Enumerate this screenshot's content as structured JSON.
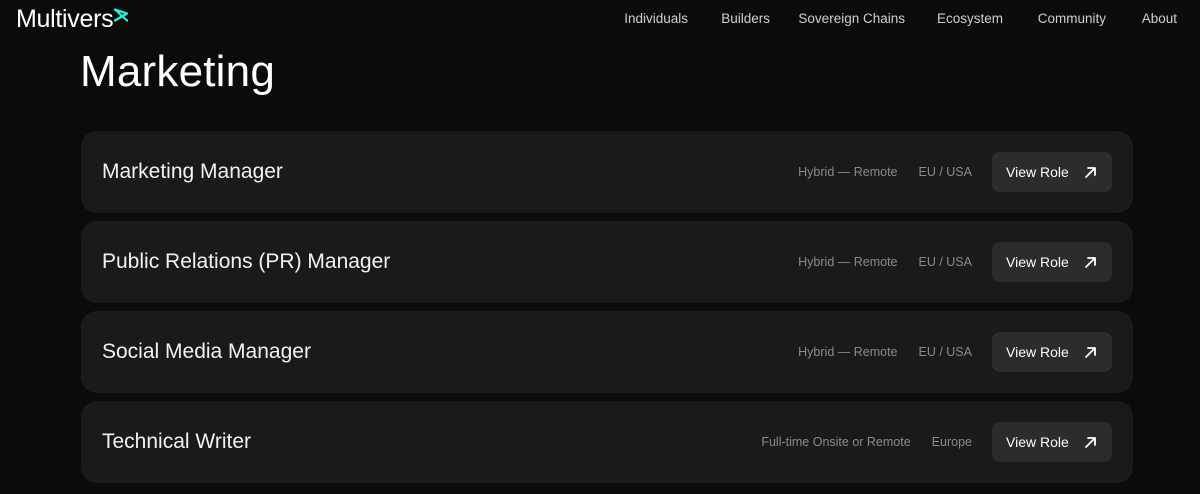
{
  "brand": {
    "name": "Multivers",
    "accent_color": "#23f7dd"
  },
  "nav": {
    "items": [
      {
        "label": "Individuals"
      },
      {
        "label": "Builders"
      },
      {
        "label": "Sovereign Chains"
      },
      {
        "label": "Ecosystem"
      },
      {
        "label": "Community"
      },
      {
        "label": "About"
      }
    ]
  },
  "section": {
    "title": "Marketing"
  },
  "jobs": [
    {
      "title": "Marketing Manager",
      "type": "Hybrid — Remote",
      "location": "EU / USA",
      "button_label": "View Role",
      "button_icon": "arrow-up-right-icon"
    },
    {
      "title": "Public Relations (PR) Manager",
      "type": "Hybrid — Remote",
      "location": "EU / USA",
      "button_label": "View Role",
      "button_icon": "arrow-up-right-icon"
    },
    {
      "title": "Social Media Manager",
      "type": "Hybrid — Remote",
      "location": "EU / USA",
      "button_label": "View Role",
      "button_icon": "arrow-up-right-icon"
    },
    {
      "title": "Technical Writer",
      "type": "Full-time Onsite or Remote",
      "location": "Europe",
      "button_label": "View Role",
      "button_icon": "arrow-up-right-icon"
    }
  ]
}
